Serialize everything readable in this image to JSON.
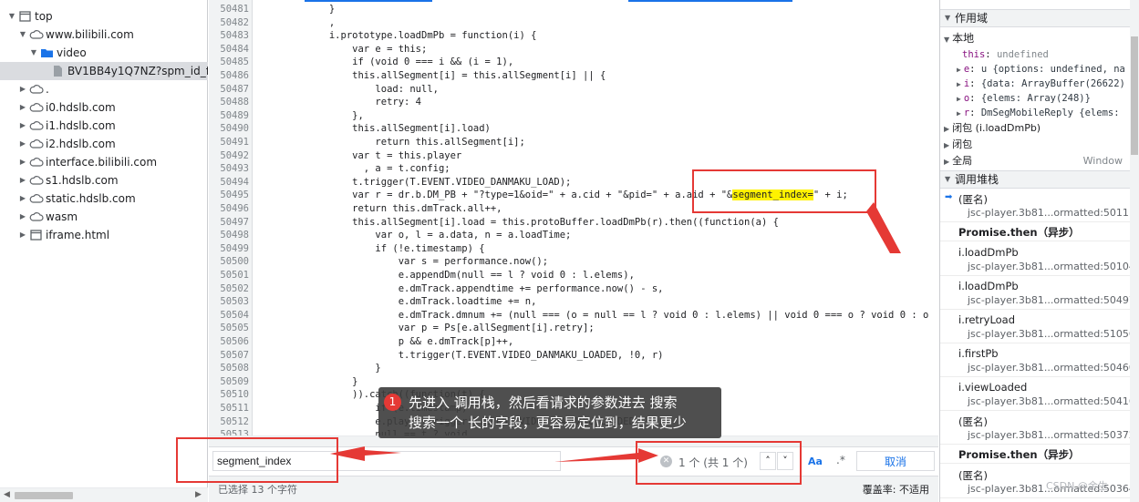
{
  "tree": {
    "items": [
      {
        "label": "top",
        "arrow": "▼",
        "icon": "frame-icon",
        "depth": 0
      },
      {
        "label": "www.bilibili.com",
        "arrow": "▼",
        "icon": "cloud-icon",
        "depth": 1
      },
      {
        "label": "video",
        "arrow": "▼",
        "icon": "folder-icon",
        "depth": 2
      },
      {
        "label": "BV1BB4y1Q7NZ?spm_id_from",
        "arrow": "",
        "icon": "file-icon",
        "depth": 3,
        "selected": true
      },
      {
        "label": ".",
        "arrow": "▶",
        "icon": "cloud-icon",
        "depth": 1
      },
      {
        "label": "i0.hdslb.com",
        "arrow": "▶",
        "icon": "cloud-icon",
        "depth": 1
      },
      {
        "label": "i1.hdslb.com",
        "arrow": "▶",
        "icon": "cloud-icon",
        "depth": 1
      },
      {
        "label": "i2.hdslb.com",
        "arrow": "▶",
        "icon": "cloud-icon",
        "depth": 1
      },
      {
        "label": "interface.bilibili.com",
        "arrow": "▶",
        "icon": "cloud-icon",
        "depth": 1
      },
      {
        "label": "s1.hdslb.com",
        "arrow": "▶",
        "icon": "cloud-icon",
        "depth": 1
      },
      {
        "label": "static.hdslb.com",
        "arrow": "▶",
        "icon": "cloud-icon",
        "depth": 1
      },
      {
        "label": "wasm",
        "arrow": "▶",
        "icon": "cloud-icon",
        "depth": 1
      },
      {
        "label": "iframe.html",
        "arrow": "▶",
        "icon": "frame-icon",
        "depth": 1
      }
    ]
  },
  "editor": {
    "lines": [
      {
        "n": "50481",
        "code": "            }"
      },
      {
        "n": "50482",
        "code": "            ,"
      },
      {
        "n": "50483",
        "code": "            i.prototype.loadDmPb = function(i) {"
      },
      {
        "n": "50484",
        "code": "                var e = this;"
      },
      {
        "n": "50485",
        "code": "                if (void 0 === i && (i = 1),"
      },
      {
        "n": "50486",
        "code": "                this.allSegment[i] = this.allSegment[i] || {"
      },
      {
        "n": "50487",
        "code": "                    load: null,"
      },
      {
        "n": "50488",
        "code": "                    retry: 4"
      },
      {
        "n": "50489",
        "code": "                },"
      },
      {
        "n": "50490",
        "code": "                this.allSegment[i].load)"
      },
      {
        "n": "50491",
        "code": "                    return this.allSegment[i];"
      },
      {
        "n": "50492",
        "code": "                var t = this.player"
      },
      {
        "n": "50493",
        "code": "                  , a = t.config;"
      },
      {
        "n": "50494",
        "code": "                t.trigger(T.EVENT.VIDEO_DANMAKU_LOAD);"
      },
      {
        "n": "50495",
        "code": "                var r = dr.b.DM_PB + \"?type=1&oid=\" + a.cid + \"&pid=\" + a.aid + \"&",
        "hl": "segment_index=",
        "after": "\" + i;"
      },
      {
        "n": "50496",
        "code": "                return this.dmTrack.all++,"
      },
      {
        "n": "50497",
        "code": "                this.allSegment[i].load = this.protoBuffer.loadDmPb(r).then((function(a) {"
      },
      {
        "n": "50498",
        "code": "                    var o, l = a.data, n = a.loadTime;"
      },
      {
        "n": "50499",
        "code": "                    if (!e.timestamp) {"
      },
      {
        "n": "50500",
        "code": "                        var s = performance.now();"
      },
      {
        "n": "50501",
        "code": "                        e.appendDm(null == l ? void 0 : l.elems),"
      },
      {
        "n": "50502",
        "code": "                        e.dmTrack.appendtime += performance.now() - s,"
      },
      {
        "n": "50503",
        "code": "                        e.dmTrack.loadtime += n,"
      },
      {
        "n": "50504",
        "code": "                        e.dmTrack.dmnum += (null === (o = null == l ? void 0 : l.elems) || void 0 === o ? void 0 : o"
      },
      {
        "n": "50505",
        "code": "                        var p = Ps[e.allSegment[i].retry];"
      },
      {
        "n": "50506",
        "code": "                        p && e.dmTrack[p]++,"
      },
      {
        "n": "50507",
        "code": "                        t.trigger(T.EVENT.VIDEO_DANMAKU_LOADED, !0, r)"
      },
      {
        "n": "50508",
        "code": "                    }"
      },
      {
        "n": "50509",
        "code": "                }"
      },
      {
        "n": "50510",
        "code": "                )).catch((function(t) {"
      },
      {
        "n": "50511",
        "code": "                    if (e.timestamp)"
      },
      {
        "n": "50512",
        "code": "                    e.player.trigger(T.EVENT.VIDEO_DANMAKU_LOADED, !1,"
      },
      {
        "n": "50513",
        "code": "                    null == t ? void"
      }
    ]
  },
  "search": {
    "value": "segment_index",
    "match_count": "1 个 (共 1 个)",
    "prev": "˄",
    "next": "˅",
    "match_case": "Aa",
    "regex": ".*",
    "cancel": "取消"
  },
  "status": {
    "selection": "已选择 13 个字符",
    "coverage": "覆盖率: 不适用"
  },
  "scope": {
    "title": "作用域",
    "local": "本地",
    "rows": [
      {
        "name": "this",
        "value": "undefined",
        "tri": ""
      },
      {
        "name": "e",
        "value": "u {options: undefined, na",
        "tri": "▶"
      },
      {
        "name": "i",
        "value": "{data: ArrayBuffer(26622)",
        "tri": "▶"
      },
      {
        "name": "o",
        "value": "{elems: Array(248)}",
        "tri": "▶"
      },
      {
        "name": "r",
        "value": "DmSegMobileReply {elems:",
        "tri": "▶"
      }
    ],
    "closure_loaddmpb": "闭包 (i.loadDmPb)",
    "closure": "闭包",
    "global": "全局",
    "global_value": "Window"
  },
  "callstack": {
    "title": "调用堆栈",
    "frames": [
      {
        "type": "frame",
        "name": "(匿名)",
        "loc": "jsc-player.3b81...ormatted:50111",
        "current": true
      },
      {
        "type": "async",
        "name": "Promise.then（异步）"
      },
      {
        "type": "frame",
        "name": "i.loadDmPb",
        "loc": "jsc-player.3b81...ormatted:50104"
      },
      {
        "type": "frame",
        "name": "i.loadDmPb",
        "loc": "jsc-player.3b81...ormatted:50497"
      },
      {
        "type": "frame",
        "name": "i.retryLoad",
        "loc": "jsc-player.3b81...ormatted:51056"
      },
      {
        "type": "frame",
        "name": "i.firstPb",
        "loc": "jsc-player.3b81...ormatted:50460"
      },
      {
        "type": "frame",
        "name": "i.viewLoaded",
        "loc": "jsc-player.3b81...ormatted:50416"
      },
      {
        "type": "frame",
        "name": "(匿名)",
        "loc": "jsc-player.3b81...ormatted:50372"
      },
      {
        "type": "async",
        "name": "Promise.then（异步）"
      },
      {
        "type": "frame",
        "name": "(匿名)",
        "loc": "jsc-player.3b81...ormatted:50364"
      }
    ]
  },
  "annotation": {
    "badge": "1",
    "line1": "先进入 调用栈，然后看请求的参数进去 搜索",
    "line2": "搜索一个 长的字段，更容易定位到，结果更少",
    "color": "#e53935"
  },
  "watermark": "CSDN @余生"
}
